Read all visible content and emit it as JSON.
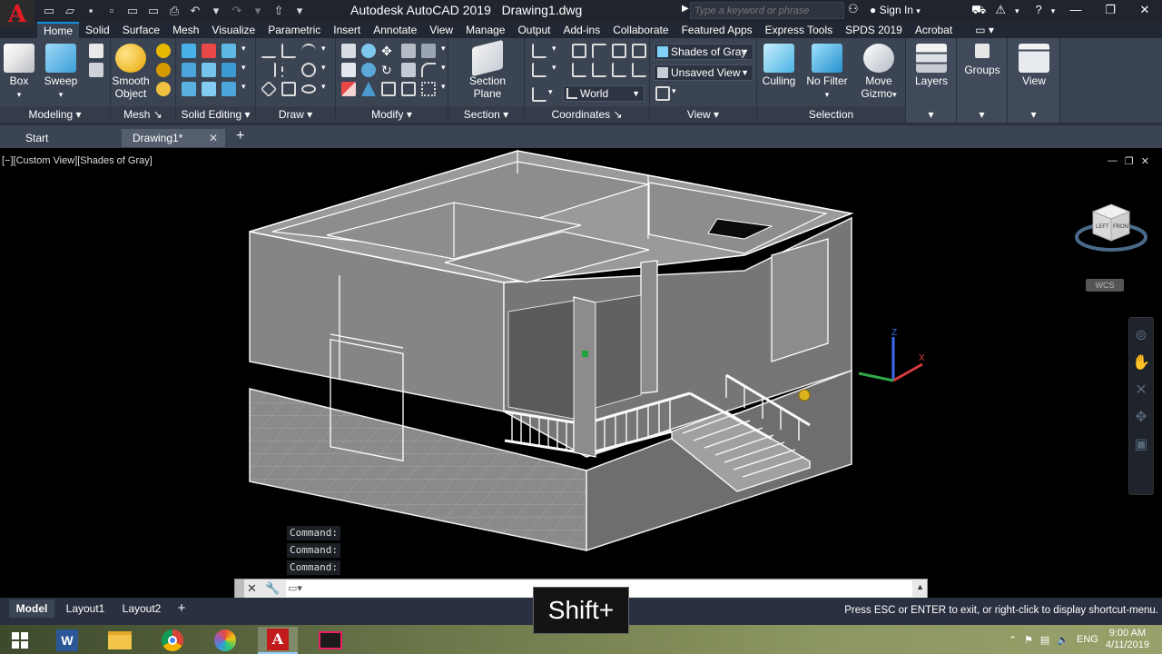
{
  "window": {
    "title": "Autodesk AutoCAD 2019",
    "file": "Drawing1.dwg",
    "search_placeholder": "Type a keyword or phrase",
    "sign_in": "Sign In"
  },
  "ribbon_tabs": [
    "Home",
    "Solid",
    "Surface",
    "Mesh",
    "Visualize",
    "Parametric",
    "Insert",
    "Annotate",
    "View",
    "Manage",
    "Output",
    "Add-ins",
    "Collaborate",
    "Featured Apps",
    "Express Tools",
    "SPDS 2019",
    "Acrobat"
  ],
  "panels": {
    "modeling": {
      "title": "Modeling",
      "box": "Box",
      "sweep": "Sweep"
    },
    "mesh": {
      "title": "Mesh",
      "smooth1": "Smooth",
      "smooth2": "Object"
    },
    "solid_editing": {
      "title": "Solid Editing"
    },
    "draw": {
      "title": "Draw"
    },
    "modify": {
      "title": "Modify"
    },
    "section": {
      "title": "Section",
      "btn1": "Section",
      "btn2": "Plane"
    },
    "coordinates": {
      "title": "Coordinates",
      "world": "World"
    },
    "view": {
      "title": "View",
      "visual_style": "Shades of Gray",
      "named_view": "Unsaved View"
    },
    "selection": {
      "title": "Selection",
      "culling": "Culling",
      "no_filter": "No Filter",
      "move1": "Move",
      "move2": "Gizmo"
    },
    "layers": {
      "title": "Layers"
    },
    "groups": {
      "title": "Groups"
    },
    "viewp": {
      "title": "View"
    }
  },
  "file_tabs": {
    "start": "Start",
    "drawing": "Drawing1*"
  },
  "viewport": {
    "label": "[−][Custom View][Shades of Gray]",
    "wcs": "WCS",
    "viewcube_left": "LEFT",
    "viewcube_front": "FRONT",
    "axis_z": "Z",
    "axis_x": "X"
  },
  "command": {
    "history": [
      "Command:",
      "Command:",
      "Command:"
    ],
    "input_value": ""
  },
  "layout_tabs": [
    "Model",
    "Layout1",
    "Layout2"
  ],
  "status_message": "Press ESC or ENTER to exit, or right-click to display shortcut-menu.",
  "key_overlay": "Shift+",
  "taskbar": {
    "lang": "ENG",
    "time": "9:00 AM",
    "date": "4/11/2019"
  },
  "colors": {
    "accent": "#0f8fe0",
    "autocad_red": "#e31b23",
    "ribbon_bg": "#3b4453"
  }
}
